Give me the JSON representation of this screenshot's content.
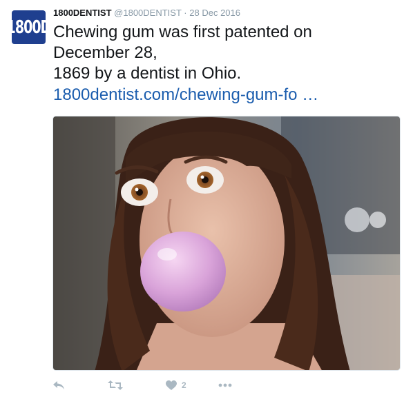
{
  "tweet": {
    "avatar_text": "1800D",
    "display_name": "1800DENTIST",
    "handle": "@1800DENTIST",
    "separator": "·",
    "date": "28 Dec 2016",
    "text_lines": [
      "Chewing gum was first patented on",
      "December 28,",
      "1869 by a dentist in Ohio."
    ],
    "link": "1800dentist.com/chewing-gum-fo …"
  },
  "actions": {
    "reply_icon": "reply-icon",
    "retweet_icon": "retweet-icon",
    "like_icon": "heart-icon",
    "like_count": "2",
    "more_icon": "more-icon"
  },
  "colors": {
    "text": "#14171a",
    "muted": "#8899a6",
    "link": "#1b5dae",
    "action_icon": "#aab8c2",
    "avatar_bg": "#1f3f8f"
  }
}
